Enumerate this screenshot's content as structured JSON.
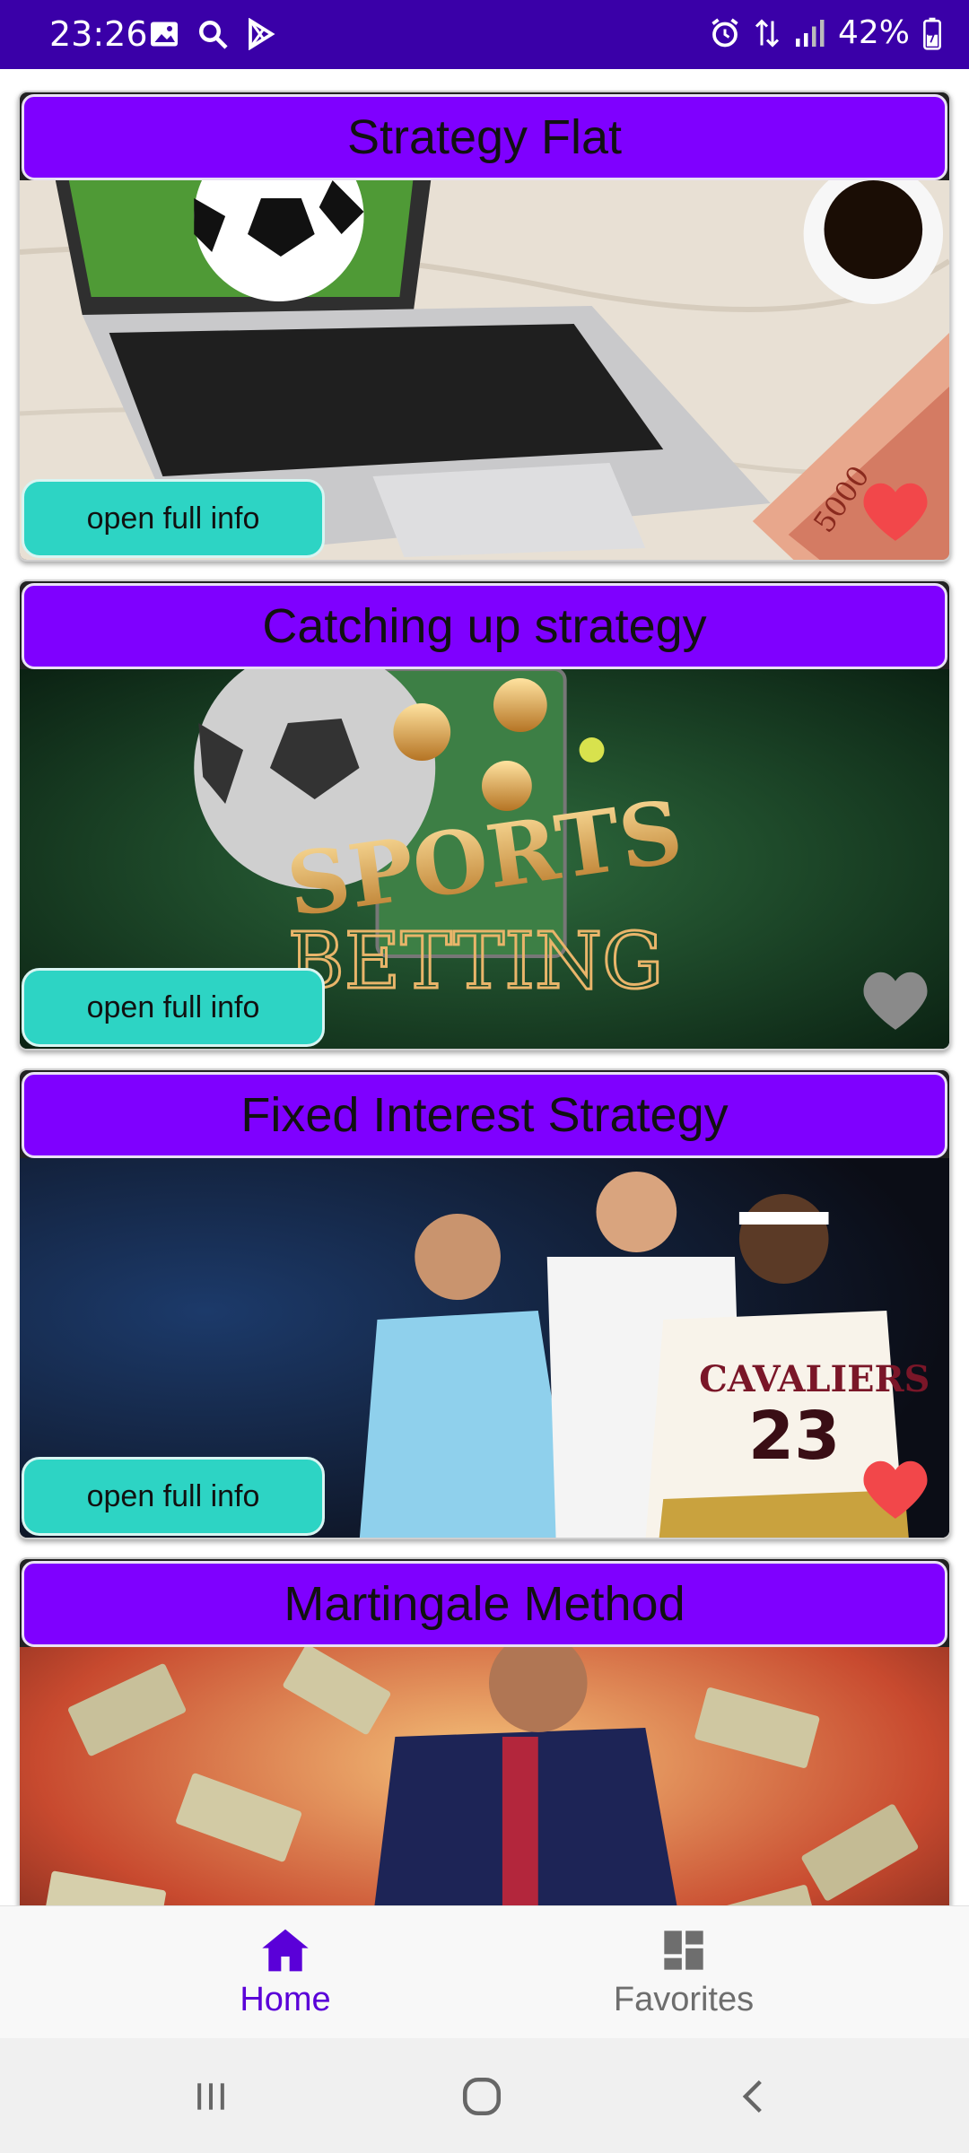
{
  "status_bar": {
    "time": "23:26",
    "battery": "42%",
    "left_icons": [
      "gallery-icon",
      "search-icon",
      "play-store-icon"
    ],
    "right_icons": [
      "alarm-icon",
      "data-arrows-icon",
      "signal-icon",
      "battery-icon"
    ]
  },
  "cards": [
    {
      "title": "Strategy Flat",
      "button": "open full info",
      "favorite": true,
      "image": "laptop-soccer-ball-coffee-money"
    },
    {
      "title": "Catching up strategy",
      "button": "open full info",
      "favorite": false,
      "image": "sports-betting-soccer-ball"
    },
    {
      "title": "Fixed Interest Strategy",
      "button": "open full info",
      "favorite": true,
      "image": "athletes-tennis-football-basketball"
    },
    {
      "title": "Martingale Method",
      "button": "open full info",
      "favorite": false,
      "image": "soccer-player-flying-money"
    }
  ],
  "image_texts": {
    "sports": "SPORTS",
    "betting": "BETTING",
    "team": "CAVALIERS",
    "jersey_number": "23",
    "banknote": "5000"
  },
  "bottom_nav": {
    "home_label": "Home",
    "favorites_label": "Favorites",
    "active": "Home"
  },
  "colors": {
    "status_bar": "#3a00a8",
    "title_bar": "#7f00ff",
    "button": "#2dd4c4",
    "heart_active": "#f2474a",
    "heart_inactive": "#8a8a8a",
    "nav_active": "#5a00d8",
    "nav_inactive": "#6e6e6e"
  }
}
